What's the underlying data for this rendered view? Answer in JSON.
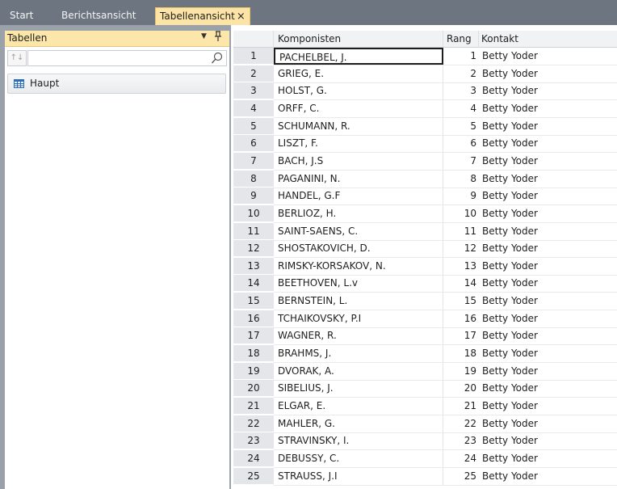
{
  "tabs": [
    {
      "label": "Start"
    },
    {
      "label": "Berichtsansicht"
    },
    {
      "label": "Tabellenansicht",
      "close_glyph": "×"
    }
  ],
  "sidebar": {
    "panel_title": "Tabellen",
    "dropdown_glyph": "▼",
    "pin_glyph": "Ᵽ",
    "sort_glyph": "↑↓",
    "search": {
      "value": "",
      "placeholder": ""
    },
    "items": [
      {
        "label": "Haupt",
        "icon": "table-grid-icon"
      }
    ]
  },
  "grid": {
    "columns": [
      "Komponisten",
      "Rang",
      "Kontakt"
    ],
    "selected": {
      "row": 1,
      "column": "Komponisten"
    },
    "rows": [
      {
        "n": "1",
        "komponist": "PACHELBEL, J.",
        "rang": "1",
        "kontakt": "Betty Yoder"
      },
      {
        "n": "2",
        "komponist": "GRIEG, E.",
        "rang": "2",
        "kontakt": "Betty Yoder"
      },
      {
        "n": "3",
        "komponist": "HOLST, G.",
        "rang": "3",
        "kontakt": "Betty Yoder"
      },
      {
        "n": "4",
        "komponist": "ORFF, C.",
        "rang": "4",
        "kontakt": "Betty Yoder"
      },
      {
        "n": "5",
        "komponist": "SCHUMANN, R.",
        "rang": "5",
        "kontakt": "Betty Yoder"
      },
      {
        "n": "6",
        "komponist": "LISZT, F.",
        "rang": "6",
        "kontakt": "Betty Yoder"
      },
      {
        "n": "7",
        "komponist": "BACH, J.S",
        "rang": "7",
        "kontakt": "Betty Yoder"
      },
      {
        "n": "8",
        "komponist": "PAGANINI, N.",
        "rang": "8",
        "kontakt": "Betty Yoder"
      },
      {
        "n": "9",
        "komponist": "HANDEL, G.F",
        "rang": "9",
        "kontakt": "Betty Yoder"
      },
      {
        "n": "10",
        "komponist": "BERLIOZ, H.",
        "rang": "10",
        "kontakt": "Betty Yoder"
      },
      {
        "n": "11",
        "komponist": "SAINT-SAENS, C.",
        "rang": "11",
        "kontakt": "Betty Yoder"
      },
      {
        "n": "12",
        "komponist": "SHOSTAKOVICH, D.",
        "rang": "12",
        "kontakt": "Betty Yoder"
      },
      {
        "n": "13",
        "komponist": "RIMSKY-KORSAKOV, N.",
        "rang": "13",
        "kontakt": "Betty Yoder"
      },
      {
        "n": "14",
        "komponist": "BEETHOVEN, L.v",
        "rang": "14",
        "kontakt": "Betty Yoder"
      },
      {
        "n": "15",
        "komponist": "BERNSTEIN, L.",
        "rang": "15",
        "kontakt": "Betty Yoder"
      },
      {
        "n": "16",
        "komponist": "TCHAIKOVSKY, P.I",
        "rang": "16",
        "kontakt": "Betty Yoder"
      },
      {
        "n": "17",
        "komponist": "WAGNER, R.",
        "rang": "17",
        "kontakt": "Betty Yoder"
      },
      {
        "n": "18",
        "komponist": "BRAHMS, J.",
        "rang": "18",
        "kontakt": "Betty Yoder"
      },
      {
        "n": "19",
        "komponist": "DVORAK, A.",
        "rang": "19",
        "kontakt": "Betty Yoder"
      },
      {
        "n": "20",
        "komponist": "SIBELIUS, J.",
        "rang": "20",
        "kontakt": "Betty Yoder"
      },
      {
        "n": "21",
        "komponist": "ELGAR, E.",
        "rang": "21",
        "kontakt": "Betty Yoder"
      },
      {
        "n": "22",
        "komponist": "MAHLER, G.",
        "rang": "22",
        "kontakt": "Betty Yoder"
      },
      {
        "n": "23",
        "komponist": "STRAVINSKY, I.",
        "rang": "23",
        "kontakt": "Betty Yoder"
      },
      {
        "n": "24",
        "komponist": "DEBUSSY, C.",
        "rang": "24",
        "kontakt": "Betty Yoder"
      },
      {
        "n": "25",
        "komponist": "STRAUSS, J.I",
        "rang": "25",
        "kontakt": "Betty Yoder"
      }
    ]
  }
}
